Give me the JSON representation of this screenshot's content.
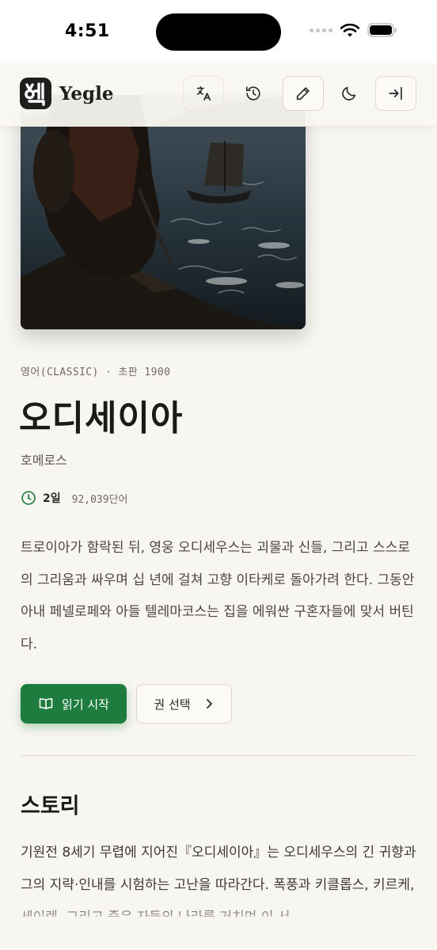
{
  "status_bar": {
    "time": "4:51"
  },
  "header": {
    "logo_glyph": "옛",
    "app_name": "Yegle",
    "icons": [
      "translate-icon",
      "history-icon",
      "pencil-icon",
      "moon-icon",
      "login-icon"
    ]
  },
  "book": {
    "meta": "영어(CLASSIC) · 초판 1900",
    "title": "오디세이아",
    "author": "호메로스",
    "duration": "2일",
    "word_count": "92,039단어",
    "summary": "트로이아가 함락된 뒤, 영웅 오디세우스는 괴물과 신들, 그리고 스스로의 그리움과 싸우며 십 년에 걸쳐 고향 이타케로 돌아가려 한다. 그동안 아내 페넬로페와 아들 텔레마코스는 집을 에워싼 구혼자들에 맞서 버틴다."
  },
  "actions": {
    "read_label": "읽기 시작",
    "volume_label": "권 선택"
  },
  "story": {
    "heading": "스토리",
    "text": "기원전 8세기 무렵에 지어진『오디세이아』는 오디세우스의 긴 귀향과 그의 지략·인내를 시험하는 고난을 따라간다. 폭풍과 키클롭스, 키르케, 세이렌, 그리고 죽은 자들의 나라를 거치며 이 서"
  },
  "colors": {
    "background": "#f8f6f1",
    "accent_green": "#1e7d3e",
    "logo_dark": "#1f1f1e"
  }
}
